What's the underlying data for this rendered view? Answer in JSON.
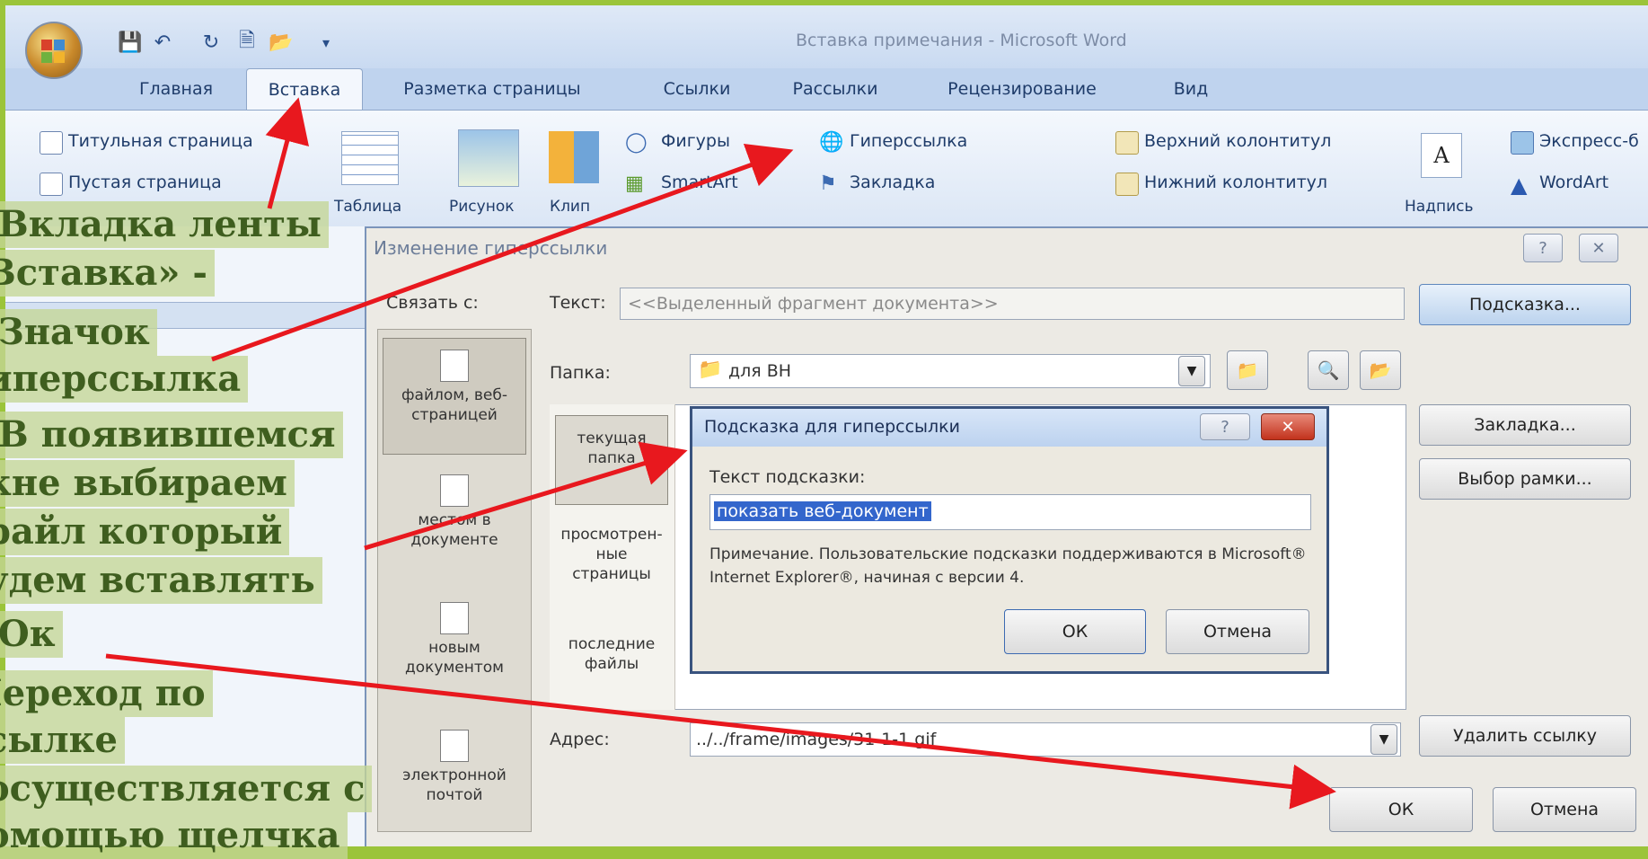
{
  "window": {
    "title": "Вставка примечания - Microsoft Word",
    "qat_icons": [
      "save-icon",
      "undo-icon",
      "redo-icon",
      "print-preview-icon",
      "open-folder-icon",
      "qat-dropdown-icon"
    ]
  },
  "tabs": [
    "Главная",
    "Вставка",
    "Разметка страницы",
    "Ссылки",
    "Рассылки",
    "Рецензирование",
    "Вид"
  ],
  "ribbon": {
    "pages": [
      "Титульная страница",
      "Пустая страница"
    ],
    "table": "Таблица",
    "picture": "Рисунок",
    "clip": "Клип",
    "shapes": "Фигуры",
    "smartart": "SmartArt",
    "hyperlink": "Гиперссылка",
    "bookmark": "Закладка",
    "header": "Верхний колонтитул",
    "footer": "Нижний колонтитул",
    "textbox": "Надпись",
    "express": "Экспресс-б",
    "wordart": "WordArt"
  },
  "dialog": {
    "title": "Изменение гиперссылки",
    "link_to_label": "Связать с:",
    "text_label": "Текст:",
    "text_value": "<<Выделенный фрагмент документа>>",
    "tip_button": "Подсказка...",
    "folder_label": "Папка:",
    "folder_value": "для ВН",
    "link_options": [
      "файлом, веб-страницей",
      "местом в документе",
      "новым документом",
      "электронной почтой"
    ],
    "browse_options": [
      "текущая папка",
      "просмотрен-ные страницы",
      "последние файлы"
    ],
    "bookmark_button": "Закладка...",
    "frame_button": "Выбор рамки...",
    "remove_link_button": "Удалить ссылку",
    "address_label": "Адрес:",
    "address_value": "../../frame/images/31-1-1.gif",
    "ok": "ОК",
    "cancel": "Отмена"
  },
  "tip_dialog": {
    "title": "Подсказка для гиперссылки",
    "label": "Текст подсказки:",
    "value": "показать веб-документ",
    "note": "Примечание. Пользовательские подсказки поддерживаются в Microsoft® Internet Explorer®, начиная с версии 4.",
    "ok": "ОК",
    "cancel": "Отмена"
  },
  "annotations": [
    ".Вкладка ленты",
    "Вставка» -",
    ".Значок",
    "иперссылка",
    ".В появившемся",
    "кне выбираем",
    "райл который",
    "удем вставлять",
    ".Ок",
    "Іереход по",
    "сылке",
    "осуществляется с",
    "омощью щелчка"
  ],
  "colors": {
    "arrow": "#e8181e",
    "annotation_text": "#3f5e1f",
    "border_green": "#9bc43a"
  }
}
